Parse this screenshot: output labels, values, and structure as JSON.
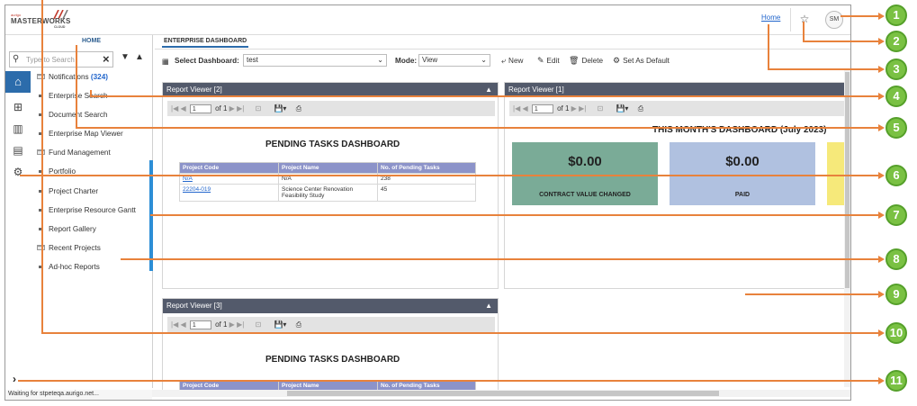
{
  "app": {
    "brand_top": "aurigo",
    "brand_main": "MASTERWORKS",
    "brand_sub": "CLOUD",
    "home_link": "Home",
    "avatar_initials": "SM",
    "accent_color": "#2c6cab",
    "callout_color": "#e8823c",
    "callout_badge_color": "#7ac143"
  },
  "left_panel": {
    "home_tab": "HOME",
    "search_placeholder": "Type to Search",
    "nav_items": [
      {
        "label": "Notifications",
        "count": "(324)",
        "kind": "folder"
      },
      {
        "label": "Enterprise Search",
        "kind": "item"
      },
      {
        "label": "Document Search",
        "kind": "item"
      },
      {
        "label": "Enterprise Map Viewer",
        "kind": "item"
      },
      {
        "label": "Fund Management",
        "kind": "folder"
      },
      {
        "label": "Portfolio",
        "kind": "item"
      },
      {
        "label": "Project Charter",
        "kind": "item"
      },
      {
        "label": "Enterprise Resource Gantt",
        "kind": "item"
      },
      {
        "label": "Report Gallery",
        "kind": "item"
      },
      {
        "label": "Recent Projects",
        "kind": "folder"
      },
      {
        "label": "Ad-hoc Reports",
        "kind": "item"
      }
    ],
    "rail_icons": [
      "home-icon",
      "hierarchy-icon",
      "reports-icon",
      "dashboard-icon",
      "gear-icon"
    ]
  },
  "main": {
    "tab_label": "ENTERPRISE DASHBOARD",
    "toolbar": {
      "select_dashboard_label": "Select Dashboard:",
      "select_dashboard_value": "test",
      "mode_label": "Mode:",
      "mode_value": "View",
      "new_label": "New",
      "edit_label": "Edit",
      "delete_label": "Delete",
      "set_default_label": "Set As Default"
    },
    "viewers": [
      {
        "title": "Report Viewer [2]",
        "page_value": "1",
        "page_of": "of 1",
        "dashboard_title": "PENDING TASKS DASHBOARD",
        "columns": [
          "Project Code",
          "Project Name",
          "No. of Pending Tasks"
        ],
        "rows": [
          {
            "code": "N/A",
            "name": "N/A",
            "count": "238"
          },
          {
            "code": "22204-019",
            "name": "Science Center Renovation Feasibility Study",
            "count": "45"
          }
        ]
      },
      {
        "title": "Report Viewer [1]",
        "page_value": "1",
        "page_of": "of 1",
        "dashboard_title": "THIS MONTH'S DASHBOARD (July 2023)",
        "cards": [
          {
            "amount": "$0.00",
            "caption": "CONTRACT VALUE CHANGED",
            "color": "#7aab97"
          },
          {
            "amount": "$0.00",
            "caption": "PAID",
            "color": "#b0c1e0"
          },
          {
            "amount": "",
            "caption": "",
            "color": "#f6e97a"
          }
        ]
      },
      {
        "title": "Report Viewer [3]",
        "page_value": "1",
        "page_of": "of 1",
        "dashboard_title": "PENDING TASKS DASHBOARD",
        "columns": [
          "Project Code",
          "Project Name",
          "No. of Pending Tasks"
        ]
      }
    ]
  },
  "status_bar": {
    "text": "Waiting for stpeteqa.aurigo.net..."
  },
  "callouts": [
    "1",
    "2",
    "3",
    "4",
    "5",
    "6",
    "7",
    "8",
    "9",
    "10",
    "11"
  ]
}
